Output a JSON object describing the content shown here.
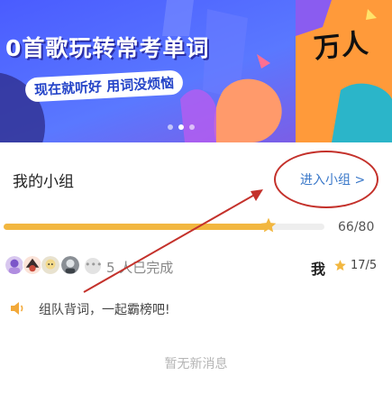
{
  "banner": {
    "title": "0首歌玩转常考单词",
    "subtitle": "现在就听好 用词没烦恼",
    "right_text": "万人",
    "accent_color": "#4d63ff"
  },
  "group": {
    "title": "我的小组",
    "enter_label": "进入小组 >"
  },
  "progress": {
    "current": 66,
    "total": 80,
    "text": "66/80",
    "fill_color": "#f2b740"
  },
  "members": {
    "avatar_icons": [
      "avatar-1",
      "avatar-2",
      "avatar-3",
      "avatar-4"
    ],
    "more_icon": "ellipsis-icon",
    "completed_text": "5 人已完成"
  },
  "me": {
    "label": "我",
    "score": "17/5"
  },
  "slogan": "组队背词，一起霸榜吧!",
  "no_message": "暂无新消息",
  "annotation_color": "#c4312b"
}
